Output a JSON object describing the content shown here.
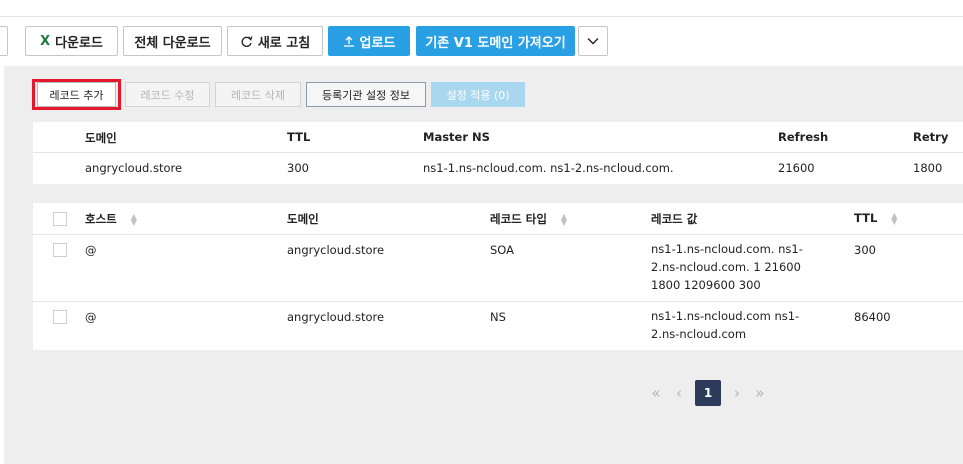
{
  "toolbar": {
    "download": "다운로드",
    "download_all": "전체 다운로드",
    "refresh": "새로 고침",
    "upload": "업로드",
    "import_v1": "기존 V1 도메인 가져오기"
  },
  "actions": {
    "add_record": "레코드 추가",
    "edit_record": "레코드 수정",
    "delete_record": "레코드 삭제",
    "registrar_info": "등록기관 설정 정보",
    "apply_settings": "설정 적용 (0)"
  },
  "soa_table": {
    "headers": [
      "도메인",
      "TTL",
      "Master NS",
      "Refresh",
      "Retry"
    ],
    "row": [
      "angrycloud.store",
      "300",
      "ns1-1.ns-ncloud.com. ns1-2.ns-ncloud.com.",
      "21600",
      "1800"
    ]
  },
  "records_table": {
    "headers": [
      "호스트",
      "도메인",
      "레코드 타입",
      "레코드 값",
      "TTL"
    ],
    "rows": [
      {
        "host": "@",
        "domain": "angrycloud.store",
        "type": "SOA",
        "value": "ns1-1.ns-ncloud.com. ns1-2.ns-ncloud.com. 1 21600 1800 1209600 300",
        "ttl": "300"
      },
      {
        "host": "@",
        "domain": "angrycloud.store",
        "type": "NS",
        "value": "ns1-1.ns-ncloud.com ns1-2.ns-ncloud.com",
        "ttl": "86400"
      }
    ]
  },
  "pagination": {
    "first": "«",
    "prev": "‹",
    "current": "1",
    "next": "›",
    "last": "»"
  },
  "colors": {
    "primary_blue": "#2aa0e4",
    "highlight_red": "#e5172d",
    "page_active": "#2d3a5c"
  }
}
